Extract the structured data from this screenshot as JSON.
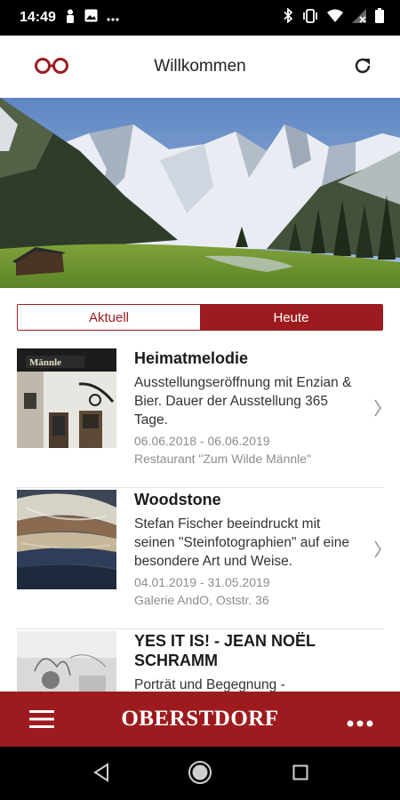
{
  "status": {
    "time": "14:49"
  },
  "header": {
    "title": "Willkommen"
  },
  "tabs": [
    {
      "label": "Aktuell",
      "active": false
    },
    {
      "label": "Heute",
      "active": true
    }
  ],
  "events": [
    {
      "title": "Heimatmelodie",
      "description": "Ausstellungseröffnung mit Enzian & Bier. Dauer der Ausstellung 365 Tage.",
      "date": "06.06.2018 - 06.06.2019",
      "place": "Restaurant \"Zum Wilde Männle\"",
      "thumb_sign": "Männle"
    },
    {
      "title": "Woodstone",
      "description": "Stefan Fischer beeindruckt mit seinen \"Steinfotographien\" auf eine besondere Art und Weise.",
      "date": "04.01.2019 - 31.05.2019",
      "place": "Galerie AndO, Oststr. 36"
    },
    {
      "title": "YES IT IS! - JEAN NOËL SCHRAMM",
      "description": "Porträt und Begegnung -",
      "date": "",
      "place": ""
    }
  ],
  "bottombar": {
    "brand": "OBERSTDORF"
  },
  "colors": {
    "brand_red": "#9d1b1f"
  },
  "icons": [
    "logo-icon",
    "refresh-icon",
    "menu-icon",
    "more-icon",
    "chevron-right-icon"
  ]
}
